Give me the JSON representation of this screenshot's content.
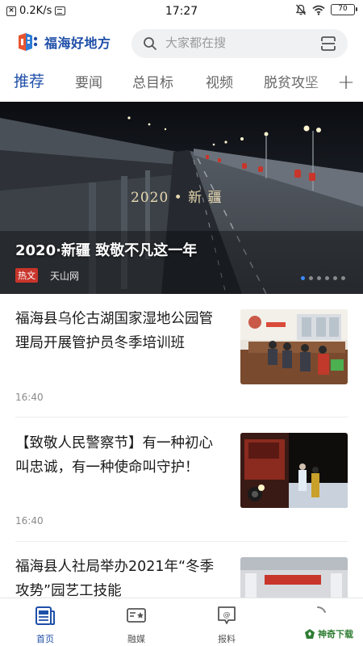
{
  "status_bar": {
    "network_speed": "0.2K/s",
    "time": "17:27",
    "battery": "70"
  },
  "header": {
    "app_name": "福海好地方",
    "search_placeholder": "大家都在搜"
  },
  "tabs": [
    "推荐",
    "要闻",
    "总目标",
    "视频",
    "脱贫攻坚"
  ],
  "active_tab": "推荐",
  "banner": {
    "image_caption": "2020 • 新 疆",
    "title": "2020·新疆 致敬不凡这一年",
    "tag": "热文",
    "source": "天山网",
    "active_slide": 1,
    "slide_count": 6
  },
  "news": [
    {
      "title": "福海县乌伦古湖国家湿地公园管理局开展管护员冬季培训班",
      "time": "16:40"
    },
    {
      "title": "【致敬人民警察节】有一种初心叫忠诚，有一种使命叫守护！",
      "time": "16:40"
    },
    {
      "title": "福海县人社局举办2021年“冬季攻势”园艺工技能",
      "time": ""
    }
  ],
  "bottom_nav": [
    {
      "label": "首页",
      "icon": "home-news-icon",
      "active": true
    },
    {
      "label": "融媒",
      "icon": "media-icon",
      "active": false
    },
    {
      "label": "报料",
      "icon": "report-icon",
      "active": false
    },
    {
      "label": "",
      "icon": "loading-icon",
      "active": false
    }
  ],
  "watermark": "神奇下载",
  "colors": {
    "brand": "#1f4fa8",
    "hot_tag": "#c8352b",
    "active_dot": "#3a8bff"
  }
}
